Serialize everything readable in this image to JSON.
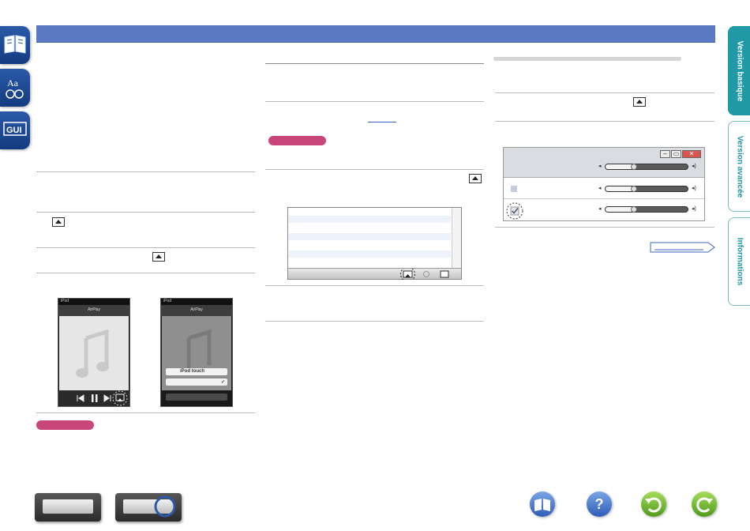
{
  "side_tabs": [
    {
      "label": "Version basique",
      "active": true
    },
    {
      "label": "Version avancée",
      "active": false
    },
    {
      "label": "Informations",
      "active": false
    }
  ],
  "left_icons": [
    "book-icon",
    "dictionary-icon",
    "gui-icon"
  ],
  "itunes_panel": {
    "airplay_icon": "airplay-icon",
    "gear_icon": "gear-icon"
  },
  "phones": [
    {
      "status": "iPod",
      "header": "AirPlay",
      "menu_items": []
    },
    {
      "status": "iPod",
      "header": "AirPlay",
      "menu_items": [
        "iPod touch",
        ""
      ]
    }
  ],
  "bottom_nav": {
    "icons": [
      "receiver-front-icon",
      "receiver-rear-icon",
      "contents-icon",
      "help-icon",
      "back-icon",
      "forward-icon"
    ],
    "help_glyph": "?"
  },
  "colors": {
    "header_bar": "#5b79c2",
    "tab_active": "#1f9aa6",
    "note_pill": "#c9467a"
  }
}
